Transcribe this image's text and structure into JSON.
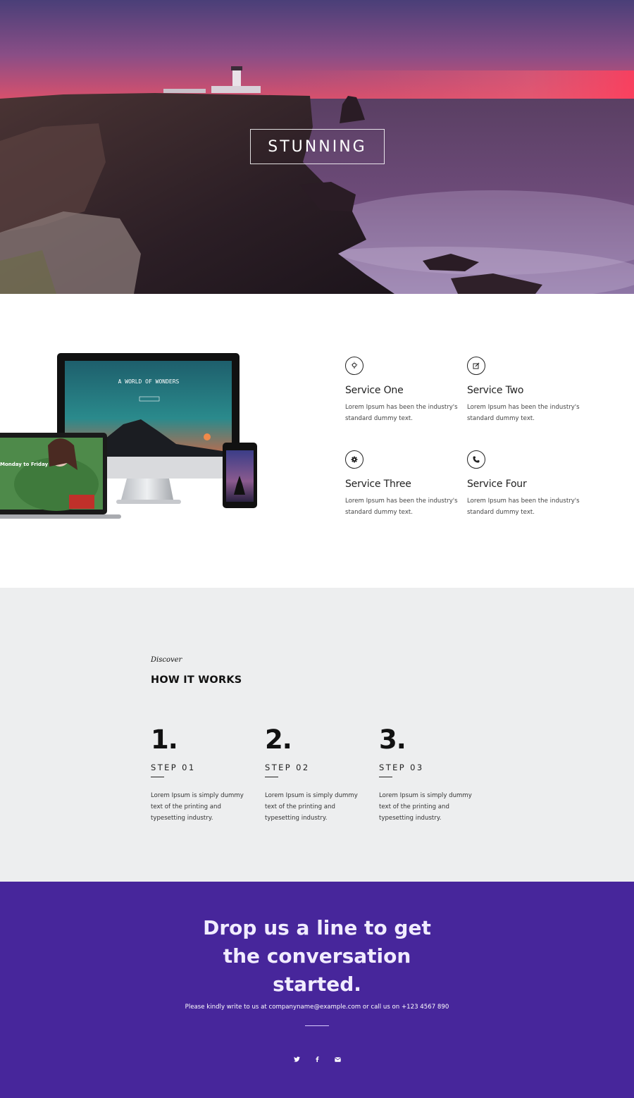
{
  "hero": {
    "title": "STUNNING"
  },
  "services": {
    "items": [
      {
        "title": "Service One",
        "text": "Lorem Ipsum has been the industry's standard dummy text.",
        "icon": "lightbulb-icon"
      },
      {
        "title": "Service Two",
        "text": "Lorem Ipsum has been the industry's standard dummy text.",
        "icon": "edit-icon"
      },
      {
        "title": "Service Three",
        "text": "Lorem Ipsum has been the industry's standard dummy text.",
        "icon": "gear-icon"
      },
      {
        "title": "Service Four",
        "text": "Lorem Ipsum has been the industry's standard dummy text.",
        "icon": "phone-icon"
      }
    ]
  },
  "devices": {
    "monitor_heading": "A WORLD OF WONDERS",
    "laptop_heading": "Monday to Friday"
  },
  "how": {
    "kicker": "Discover",
    "title": "HOW IT WORKS",
    "steps": [
      {
        "num": "1.",
        "label": "STEP 01",
        "text": "Lorem Ipsum is simply dummy text of the printing and typesetting industry."
      },
      {
        "num": "2.",
        "label": "STEP 02",
        "text": "Lorem Ipsum is simply dummy text of the printing and typesetting industry."
      },
      {
        "num": "3.",
        "label": "STEP 03",
        "text": "Lorem Ipsum is simply dummy text of the printing and typesetting industry."
      }
    ]
  },
  "contact": {
    "title": "Drop us a line to get the conversation started.",
    "line": "Please kindly write to us at companyname@example.com or call us on +123 4567 890",
    "socials": [
      "twitter-icon",
      "facebook-icon",
      "email-icon"
    ]
  },
  "colors": {
    "contact_bg": "#47269b",
    "how_bg": "#edeeef",
    "hero_sky_top": "#4a3f78",
    "hero_sky_glow": "#f04a63"
  }
}
